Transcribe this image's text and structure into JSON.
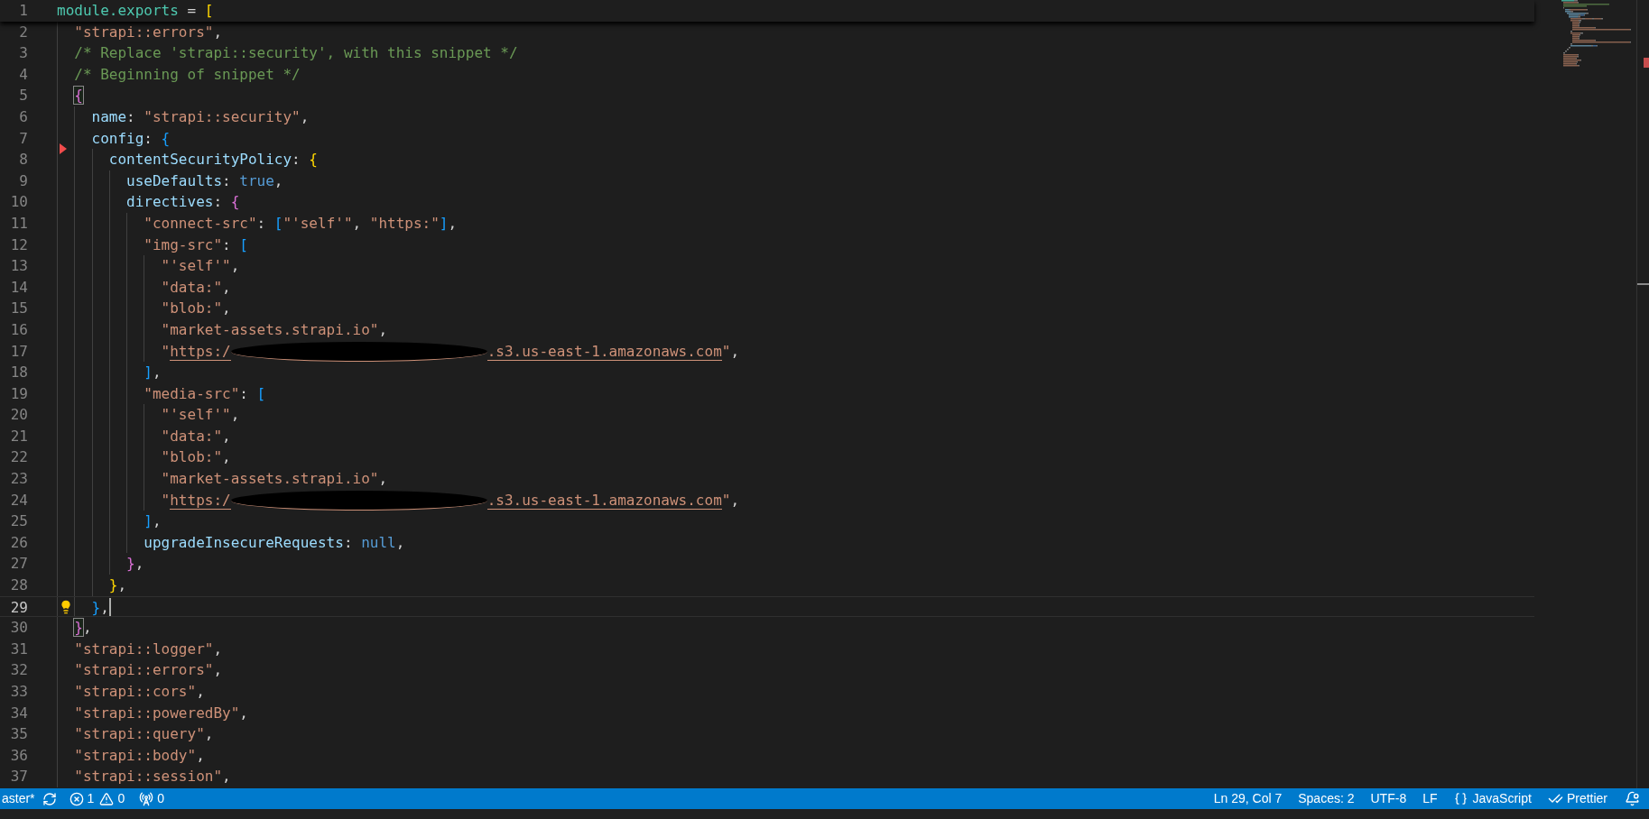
{
  "editor": {
    "lines": [
      {
        "number": "1",
        "current": false,
        "sticky": true,
        "tokens": [
          {
            "kind": "module",
            "text": "module.exports"
          },
          {
            "kind": "punct",
            "text": " = "
          },
          {
            "kind": "bracket",
            "text": "[",
            "color": "#ffd700",
            "matched": false
          }
        ],
        "children": [
          {
            "number": "2",
            "current": false,
            "sticky": false,
            "tokens": [
              {
                "kind": "string",
                "text": "\"strapi::errors\""
              },
              {
                "kind": "punct",
                "text": ","
              }
            ]
          },
          {
            "number": "3",
            "current": false,
            "sticky": false,
            "tokens": [
              {
                "kind": "comment",
                "text": "/* Replace 'strapi::security', with this snippet */"
              }
            ]
          },
          {
            "number": "4",
            "current": false,
            "sticky": false,
            "tokens": [
              {
                "kind": "comment",
                "text": "/* Beginning of snippet */"
              }
            ]
          },
          {
            "number": "5",
            "current": false,
            "sticky": false,
            "tokens": [
              {
                "kind": "bracket",
                "text": "{",
                "color": "#da70d6",
                "matched": true
              }
            ],
            "children": [
              {
                "number": "6",
                "current": false,
                "sticky": false,
                "tokens": [
                  {
                    "kind": "prop",
                    "text": "name"
                  },
                  {
                    "kind": "punct",
                    "text": ": "
                  },
                  {
                    "kind": "string",
                    "text": "\"strapi::security\""
                  },
                  {
                    "kind": "punct",
                    "text": ","
                  }
                ]
              },
              {
                "number": "7",
                "current": false,
                "sticky": false,
                "gutter": {
                  "kind": "deleted"
                },
                "tokens": [
                  {
                    "kind": "prop",
                    "text": "config"
                  },
                  {
                    "kind": "punct",
                    "text": ": "
                  },
                  {
                    "kind": "bracket",
                    "text": "{",
                    "color": "#179fff",
                    "matched": false
                  }
                ],
                "children": [
                  {
                    "number": "8",
                    "current": false,
                    "sticky": false,
                    "tokens": [
                      {
                        "kind": "prop",
                        "text": "contentSecurityPolicy"
                      },
                      {
                        "kind": "punct",
                        "text": ": "
                      },
                      {
                        "kind": "bracket",
                        "text": "{",
                        "color": "#ffd700",
                        "matched": false
                      }
                    ],
                    "children": [
                      {
                        "number": "9",
                        "current": false,
                        "sticky": false,
                        "tokens": [
                          {
                            "kind": "prop",
                            "text": "useDefaults"
                          },
                          {
                            "kind": "punct",
                            "text": ": "
                          },
                          {
                            "kind": "literal",
                            "text": "true"
                          },
                          {
                            "kind": "punct",
                            "text": ","
                          }
                        ]
                      },
                      {
                        "number": "10",
                        "current": false,
                        "sticky": false,
                        "tokens": [
                          {
                            "kind": "prop",
                            "text": "directives"
                          },
                          {
                            "kind": "punct",
                            "text": ": "
                          },
                          {
                            "kind": "bracket",
                            "text": "{",
                            "color": "#da70d6",
                            "matched": false
                          }
                        ],
                        "children": [
                          {
                            "number": "11",
                            "current": false,
                            "sticky": false,
                            "tokens": [
                              {
                                "kind": "string",
                                "text": "\"connect-src\""
                              },
                              {
                                "kind": "punct",
                                "text": ": "
                              },
                              {
                                "kind": "bracket",
                                "text": "[",
                                "color": "#179fff",
                                "matched": false
                              },
                              {
                                "kind": "string",
                                "text": "\"'self'\""
                              },
                              {
                                "kind": "punct",
                                "text": ", "
                              },
                              {
                                "kind": "string",
                                "text": "\"https:\""
                              },
                              {
                                "kind": "bracket",
                                "text": "]",
                                "color": "#179fff",
                                "matched": false
                              },
                              {
                                "kind": "punct",
                                "text": ","
                              }
                            ]
                          },
                          {
                            "number": "12",
                            "current": false,
                            "sticky": false,
                            "tokens": [
                              {
                                "kind": "string",
                                "text": "\"img-src\""
                              },
                              {
                                "kind": "punct",
                                "text": ": "
                              },
                              {
                                "kind": "bracket",
                                "text": "[",
                                "color": "#179fff",
                                "matched": false
                              }
                            ],
                            "children": [
                              {
                                "number": "13",
                                "current": false,
                                "sticky": false,
                                "tokens": [
                                  {
                                    "kind": "string",
                                    "text": "\"'self'\""
                                  },
                                  {
                                    "kind": "punct",
                                    "text": ","
                                  }
                                ]
                              },
                              {
                                "number": "14",
                                "current": false,
                                "sticky": false,
                                "tokens": [
                                  {
                                    "kind": "string",
                                    "text": "\"data:\""
                                  },
                                  {
                                    "kind": "punct",
                                    "text": ","
                                  }
                                ]
                              },
                              {
                                "number": "15",
                                "current": false,
                                "sticky": false,
                                "tokens": [
                                  {
                                    "kind": "string",
                                    "text": "\"blob:\""
                                  },
                                  {
                                    "kind": "punct",
                                    "text": ","
                                  }
                                ]
                              },
                              {
                                "number": "16",
                                "current": false,
                                "sticky": false,
                                "tokens": [
                                  {
                                    "kind": "string",
                                    "text": "\"market-assets.strapi.io\""
                                  },
                                  {
                                    "kind": "punct",
                                    "text": ","
                                  }
                                ]
                              },
                              {
                                "number": "17",
                                "current": false,
                                "sticky": false,
                                "tokens": [
                                  {
                                    "kind": "string",
                                    "text": "\""
                                  },
                                  {
                                    "kind": "link",
                                    "text": "https:/"
                                  },
                                  {
                                    "kind": "redacted"
                                  },
                                  {
                                    "kind": "link",
                                    "text": ".s3.us-east-1.amazonaws.com"
                                  },
                                  {
                                    "kind": "string",
                                    "text": "\""
                                  },
                                  {
                                    "kind": "punct",
                                    "text": ","
                                  }
                                ]
                              }
                            ]
                          },
                          {
                            "number": "18",
                            "current": false,
                            "sticky": false,
                            "tokens": [
                              {
                                "kind": "bracket",
                                "text": "]",
                                "color": "#179fff",
                                "matched": false
                              },
                              {
                                "kind": "punct",
                                "text": ","
                              }
                            ]
                          },
                          {
                            "number": "19",
                            "current": false,
                            "sticky": false,
                            "tokens": [
                              {
                                "kind": "string",
                                "text": "\"media-src\""
                              },
                              {
                                "kind": "punct",
                                "text": ": "
                              },
                              {
                                "kind": "bracket",
                                "text": "[",
                                "color": "#179fff",
                                "matched": false
                              }
                            ],
                            "children": [
                              {
                                "number": "20",
                                "current": false,
                                "sticky": false,
                                "tokens": [
                                  {
                                    "kind": "string",
                                    "text": "\"'self'\""
                                  },
                                  {
                                    "kind": "punct",
                                    "text": ","
                                  }
                                ]
                              },
                              {
                                "number": "21",
                                "current": false,
                                "sticky": false,
                                "tokens": [
                                  {
                                    "kind": "string",
                                    "text": "\"data:\""
                                  },
                                  {
                                    "kind": "punct",
                                    "text": ","
                                  }
                                ]
                              },
                              {
                                "number": "22",
                                "current": false,
                                "sticky": false,
                                "tokens": [
                                  {
                                    "kind": "string",
                                    "text": "\"blob:\""
                                  },
                                  {
                                    "kind": "punct",
                                    "text": ","
                                  }
                                ]
                              },
                              {
                                "number": "23",
                                "current": false,
                                "sticky": false,
                                "tokens": [
                                  {
                                    "kind": "string",
                                    "text": "\"market-assets.strapi.io\""
                                  },
                                  {
                                    "kind": "punct",
                                    "text": ","
                                  }
                                ]
                              },
                              {
                                "number": "24",
                                "current": false,
                                "sticky": false,
                                "tokens": [
                                  {
                                    "kind": "string",
                                    "text": "\""
                                  },
                                  {
                                    "kind": "link",
                                    "text": "https:/"
                                  },
                                  {
                                    "kind": "redacted"
                                  },
                                  {
                                    "kind": "link",
                                    "text": ".s3.us-east-1.amazonaws.com"
                                  },
                                  {
                                    "kind": "string",
                                    "text": "\""
                                  },
                                  {
                                    "kind": "punct",
                                    "text": ","
                                  }
                                ]
                              }
                            ]
                          },
                          {
                            "number": "25",
                            "current": false,
                            "sticky": false,
                            "tokens": [
                              {
                                "kind": "bracket",
                                "text": "]",
                                "color": "#179fff",
                                "matched": false
                              },
                              {
                                "kind": "punct",
                                "text": ","
                              }
                            ]
                          },
                          {
                            "number": "26",
                            "current": false,
                            "sticky": false,
                            "tokens": [
                              {
                                "kind": "prop",
                                "text": "upgradeInsecureRequests"
                              },
                              {
                                "kind": "punct",
                                "text": ": "
                              },
                              {
                                "kind": "literal",
                                "text": "null"
                              },
                              {
                                "kind": "punct",
                                "text": ","
                              }
                            ]
                          }
                        ]
                      },
                      {
                        "number": "27",
                        "current": false,
                        "sticky": false,
                        "tokens": [
                          {
                            "kind": "bracket",
                            "text": "}",
                            "color": "#da70d6",
                            "matched": false
                          },
                          {
                            "kind": "punct",
                            "text": ","
                          }
                        ]
                      }
                    ]
                  },
                  {
                    "number": "28",
                    "current": false,
                    "sticky": false,
                    "tokens": [
                      {
                        "kind": "bracket",
                        "text": "}",
                        "color": "#ffd700",
                        "matched": false
                      },
                      {
                        "kind": "punct",
                        "text": ","
                      }
                    ]
                  }
                ]
              },
              {
                "number": "29",
                "current": true,
                "sticky": false,
                "gutter": {
                  "kind": "lightbulb"
                },
                "tokens": [
                  {
                    "kind": "bracket",
                    "text": "}",
                    "color": "#179fff",
                    "matched": false
                  },
                  {
                    "kind": "punct",
                    "text": ","
                  }
                ]
              }
            ]
          },
          {
            "number": "30",
            "current": false,
            "sticky": false,
            "tokens": [
              {
                "kind": "bracket",
                "text": "}",
                "color": "#da70d6",
                "matched": true
              },
              {
                "kind": "punct",
                "text": ","
              }
            ]
          },
          {
            "number": "31",
            "current": false,
            "sticky": false,
            "tokens": [
              {
                "kind": "string",
                "text": "\"strapi::logger\""
              },
              {
                "kind": "punct",
                "text": ","
              }
            ]
          },
          {
            "number": "32",
            "current": false,
            "sticky": false,
            "tokens": [
              {
                "kind": "string",
                "text": "\"strapi::errors\""
              },
              {
                "kind": "punct",
                "text": ","
              }
            ]
          },
          {
            "number": "33",
            "current": false,
            "sticky": false,
            "tokens": [
              {
                "kind": "string",
                "text": "\"strapi::cors\""
              },
              {
                "kind": "punct",
                "text": ","
              }
            ]
          },
          {
            "number": "34",
            "current": false,
            "sticky": false,
            "tokens": [
              {
                "kind": "string",
                "text": "\"strapi::poweredBy\""
              },
              {
                "kind": "punct",
                "text": ","
              }
            ]
          },
          {
            "number": "35",
            "current": false,
            "sticky": false,
            "tokens": [
              {
                "kind": "string",
                "text": "\"strapi::query\""
              },
              {
                "kind": "punct",
                "text": ","
              }
            ]
          },
          {
            "number": "36",
            "current": false,
            "sticky": false,
            "tokens": [
              {
                "kind": "string",
                "text": "\"strapi::body\""
              },
              {
                "kind": "punct",
                "text": ","
              }
            ]
          },
          {
            "number": "37",
            "current": false,
            "sticky": false,
            "tokens": [
              {
                "kind": "string",
                "text": "\"strapi::session\""
              },
              {
                "kind": "punct",
                "text": ","
              }
            ]
          }
        ]
      }
    ]
  },
  "status_bar": {
    "left": [
      {
        "kind": "branch",
        "text": "aster*"
      },
      {
        "kind": "errors",
        "text": "1"
      },
      {
        "kind": "warnings",
        "text": "0"
      },
      {
        "kind": "ports",
        "text": "0"
      }
    ],
    "right": [
      {
        "kind": "text",
        "text": "Ln 29, Col 7"
      },
      {
        "kind": "text",
        "text": "Spaces: 2"
      },
      {
        "kind": "text",
        "text": "UTF-8"
      },
      {
        "kind": "text",
        "text": "LF"
      },
      {
        "kind": "language",
        "text": "JavaScript"
      },
      {
        "kind": "formatter",
        "text": "Prettier"
      },
      {
        "kind": "notifications"
      }
    ]
  }
}
